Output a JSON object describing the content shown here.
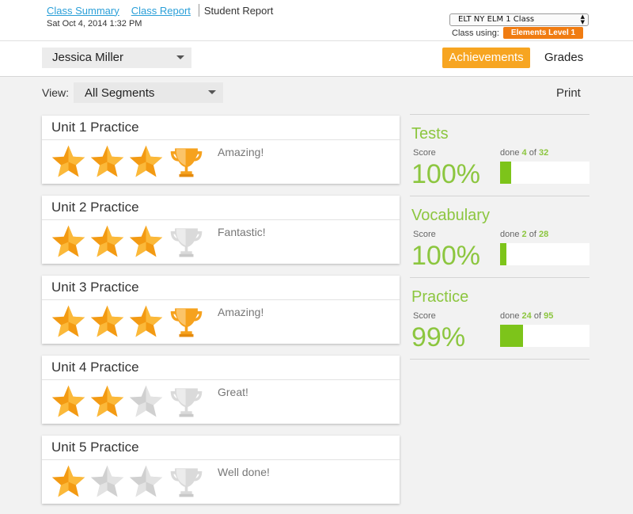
{
  "breadcrumb": {
    "class_summary": "Class Summary",
    "class_report": "Class Report",
    "student_report": "Student Report"
  },
  "timestamp": "Sat Oct 4, 2014 1:32 PM",
  "class_selector": {
    "value": "ELT NY ELM 1 Class"
  },
  "class_using": {
    "label": "Class using:",
    "level": "Elements Level 1"
  },
  "student_selector": {
    "value": "Jessica Miller"
  },
  "tabs": {
    "achievements": "Achievements",
    "grades": "Grades"
  },
  "view": {
    "label": "View:",
    "value": "All Segments"
  },
  "print_label": "Print",
  "colors": {
    "accent": "#f7a521",
    "link": "#2a9fd8",
    "badge": "#f07c12",
    "green": "#8cc63f",
    "bar": "#7dc41a",
    "star_on": "#f7a521",
    "star_off": "#dcdcdc"
  },
  "units": [
    {
      "title": "Unit 1 Practice",
      "stars": 3,
      "trophy": true,
      "praise": "Amazing!"
    },
    {
      "title": "Unit 2 Practice",
      "stars": 3,
      "trophy": false,
      "praise": "Fantastic!"
    },
    {
      "title": "Unit 3 Practice",
      "stars": 3,
      "trophy": true,
      "praise": "Amazing!"
    },
    {
      "title": "Unit 4 Practice",
      "stars": 2,
      "trophy": false,
      "praise": "Great!"
    },
    {
      "title": "Unit 5 Practice",
      "stars": 1,
      "trophy": false,
      "praise": "Well done!"
    }
  ],
  "stats": [
    {
      "title": "Tests",
      "score_label": "Score",
      "score": "100%",
      "done_prefix": "done",
      "done": "4",
      "of": "of",
      "total": "32"
    },
    {
      "title": "Vocabulary",
      "score_label": "Score",
      "score": "100%",
      "done_prefix": "done",
      "done": "2",
      "of": "of",
      "total": "28"
    },
    {
      "title": "Practice",
      "score_label": "Score",
      "score": "99%",
      "done_prefix": "done",
      "done": "24",
      "of": "of",
      "total": "95"
    }
  ]
}
